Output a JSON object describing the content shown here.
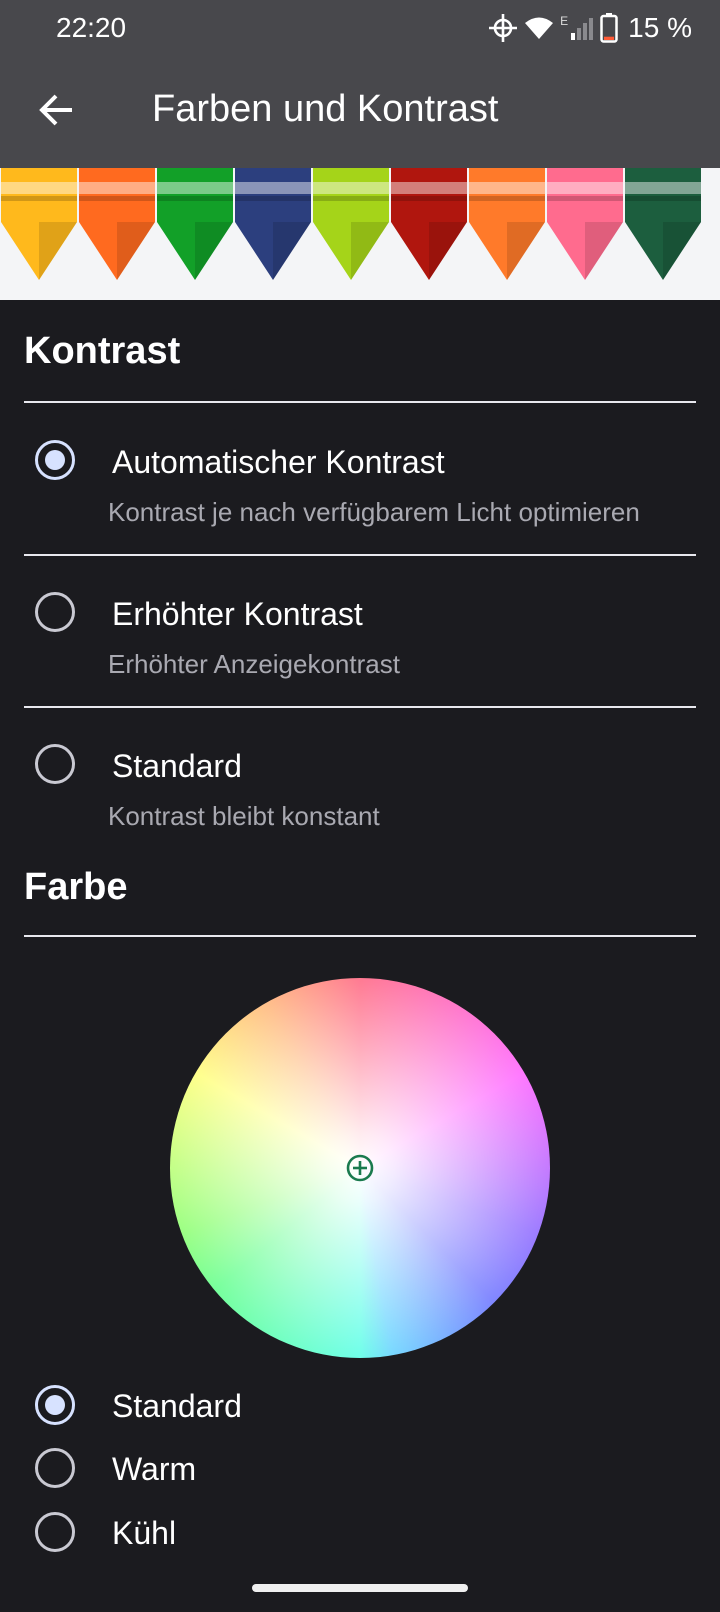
{
  "status_bar": {
    "time": "22:20",
    "icons": [
      "crosshair-icon",
      "wifi-icon",
      "signal-icon",
      "battery-icon"
    ],
    "network_type": "E",
    "battery_percent": "15 %",
    "battery_level": 0.15
  },
  "app_bar": {
    "back_icon": "arrow-left-icon",
    "title": "Farben und Kontrast"
  },
  "contrast": {
    "title": "Kontrast",
    "options": [
      {
        "label": "Automatischer Kontrast",
        "sub": "Kontrast je nach verfügbarem Licht optimieren",
        "selected": true
      },
      {
        "label": "Erhöhter Kontrast",
        "sub": "Erhöhter Anzeigekontrast",
        "selected": false
      },
      {
        "label": "Standard",
        "sub": "Kontrast bleibt konstant",
        "selected": false
      }
    ]
  },
  "color": {
    "title": "Farbe",
    "options": [
      {
        "label": "Standard",
        "selected": true
      },
      {
        "label": "Warm",
        "selected": false
      },
      {
        "label": "Kühl",
        "selected": false
      }
    ]
  },
  "colors": {
    "app_bar_bg": "#48484c",
    "page_bg": "#1b1b1f",
    "radio_selected": "#d7e2ff",
    "wheel_cursor": "#1a7a4e",
    "crayon_colors": [
      "#ffb91c",
      "#ff6a1f",
      "#12a028",
      "#2c3f7e",
      "#a5d419",
      "#b0160e",
      "#ff7a2a",
      "#ff6b8e",
      "#1c5e3e"
    ]
  }
}
